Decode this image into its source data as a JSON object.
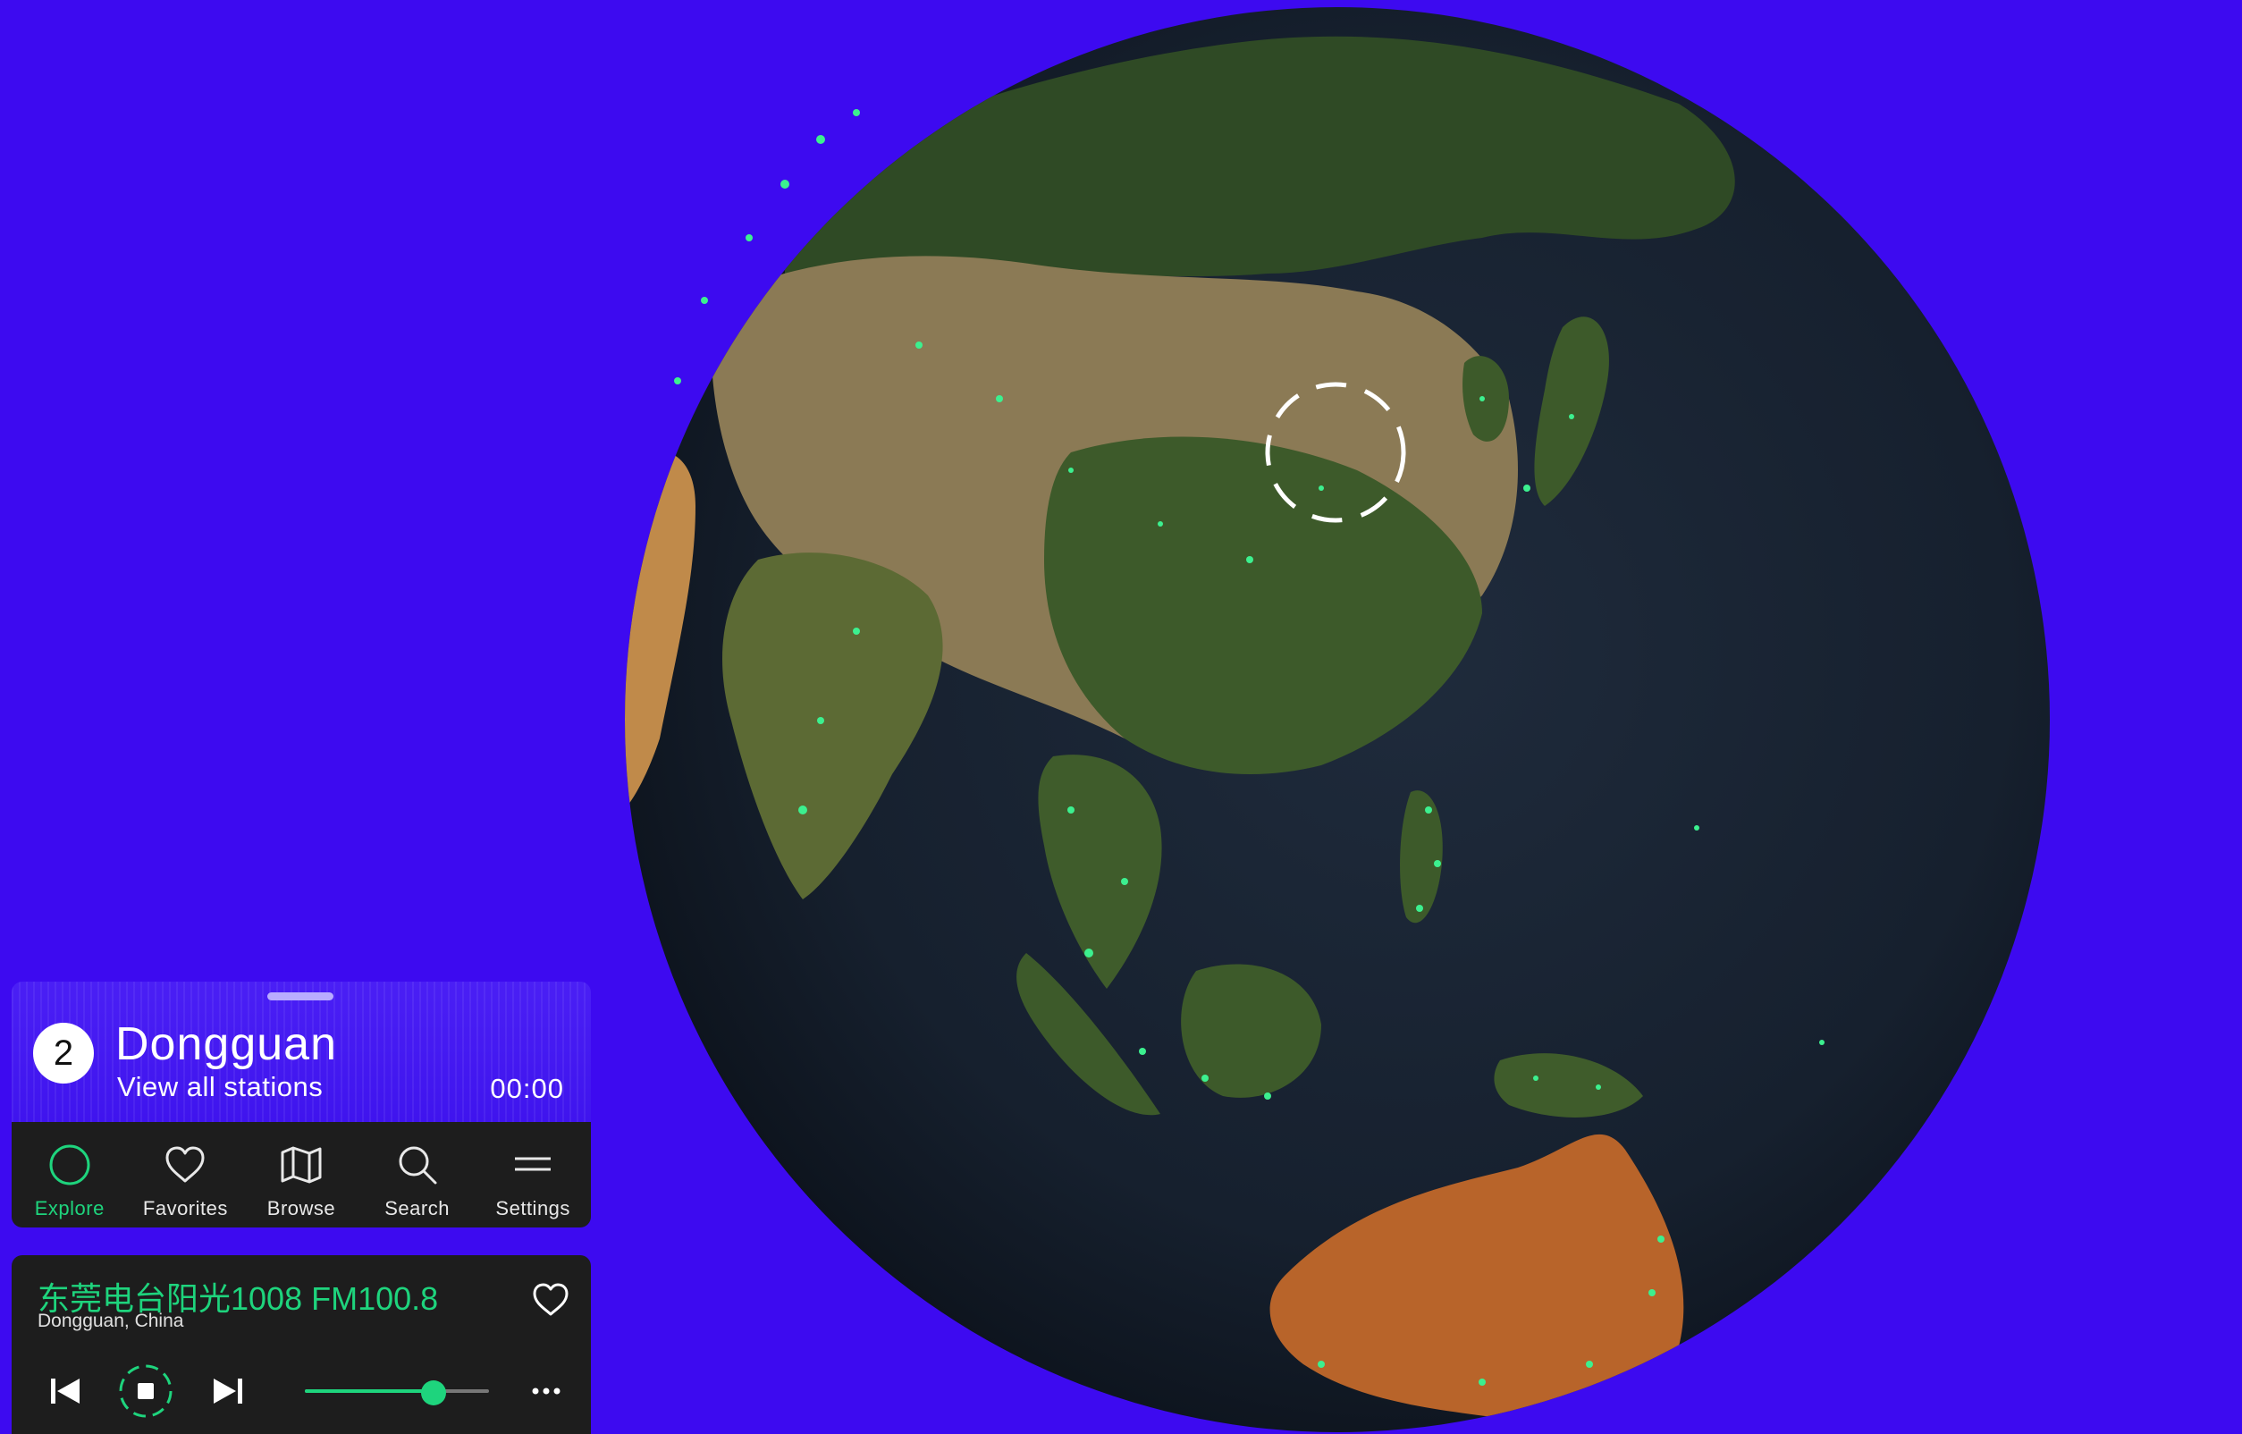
{
  "colors": {
    "background": "#3d0af0",
    "accent": "#1ed47d",
    "panel": "#1d1d1d",
    "card": "#4a1ff5"
  },
  "location": {
    "count": "2",
    "city": "Dongguan",
    "view_all": "View all stations",
    "time": "00:00"
  },
  "nav": [
    {
      "label": "Explore",
      "icon": "explore-circle-icon",
      "active": true
    },
    {
      "label": "Favorites",
      "icon": "heart-icon",
      "active": false
    },
    {
      "label": "Browse",
      "icon": "map-icon",
      "active": false
    },
    {
      "label": "Search",
      "icon": "search-icon",
      "active": false
    },
    {
      "label": "Settings",
      "icon": "menu-icon",
      "active": false
    }
  ],
  "player": {
    "station": "东莞电台阳光1008 FM100.8",
    "location": "Dongguan, China",
    "volume": 0.7,
    "icons": {
      "favorite": "heart-icon",
      "prev": "skip-previous-icon",
      "stop": "stop-icon",
      "next": "skip-next-icon",
      "more": "more-dots-icon"
    }
  },
  "globe": {
    "icon": "earth-globe",
    "selection": "dashed-circle-marker"
  }
}
